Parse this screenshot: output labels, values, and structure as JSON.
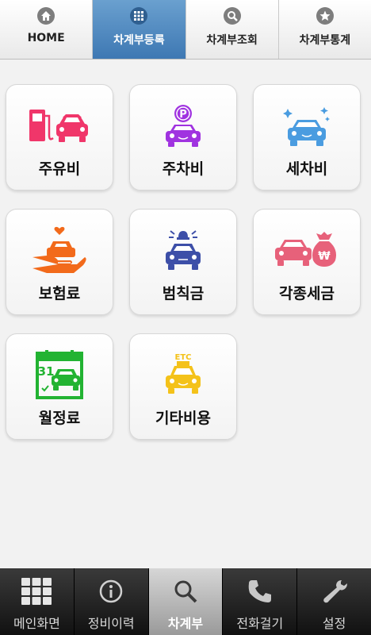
{
  "top_tabs": [
    {
      "label": "HOME",
      "icon": "home-icon",
      "active": false
    },
    {
      "label": "차계부등록",
      "icon": "grid-icon",
      "active": true
    },
    {
      "label": "차계부조회",
      "icon": "search-icon",
      "active": false
    },
    {
      "label": "차계부통계",
      "icon": "star-icon",
      "active": false
    }
  ],
  "categories": [
    {
      "label": "주유비",
      "icon": "fuel-pump-car-icon",
      "color": "#f0366a"
    },
    {
      "label": "주차비",
      "icon": "parking-car-icon",
      "color": "#a033e0"
    },
    {
      "label": "세차비",
      "icon": "car-wash-icon",
      "color": "#4a9ce0"
    },
    {
      "label": "보험료",
      "icon": "insurance-hand-car-icon",
      "color": "#f26a1b"
    },
    {
      "label": "범칙금",
      "icon": "police-car-icon",
      "color": "#3d4fa8"
    },
    {
      "label": "각종세금",
      "icon": "tax-money-bag-car-icon",
      "color": "#e7617a"
    },
    {
      "label": "월정료",
      "icon": "calendar-car-icon",
      "color": "#22b332"
    },
    {
      "label": "기타비용",
      "icon": "etc-car-icon",
      "color": "#f4c21a"
    }
  ],
  "calendar_day": "31",
  "etc_text": "ETC",
  "parking_text": "P",
  "won_text": "₩",
  "bottom_nav": [
    {
      "label": "메인화면",
      "icon": "grid-menu-icon",
      "active": false
    },
    {
      "label": "정비이력",
      "icon": "info-icon",
      "active": false
    },
    {
      "label": "차계부",
      "icon": "search-icon",
      "active": true
    },
    {
      "label": "전화걸기",
      "icon": "phone-icon",
      "active": false
    },
    {
      "label": "설정",
      "icon": "wrench-icon",
      "active": false
    }
  ]
}
